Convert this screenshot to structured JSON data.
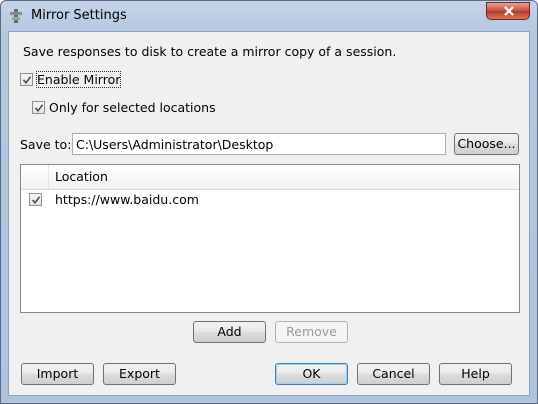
{
  "window": {
    "title": "Mirror Settings",
    "icon": "app-gear-icon",
    "close_icon": "close-icon",
    "close_color": "#c8503c"
  },
  "description": "Save responses to disk to create a mirror copy of a session.",
  "enable_mirror": {
    "label": "Enable Mirror",
    "checked": true
  },
  "only_selected": {
    "label": "Only for selected locations",
    "checked": true
  },
  "save_to": {
    "label": "Save to:",
    "value": "C:\\Users\\Administrator\\Desktop",
    "choose_label": "Choose..."
  },
  "locations": {
    "column_header": "Location",
    "rows": [
      {
        "checked": true,
        "url": "https://www.baidu.com"
      }
    ]
  },
  "list_actions": {
    "add_label": "Add",
    "remove_label": "Remove",
    "remove_enabled": false
  },
  "footer": {
    "import_label": "Import",
    "export_label": "Export",
    "ok_label": "OK",
    "cancel_label": "Cancel",
    "help_label": "Help"
  }
}
